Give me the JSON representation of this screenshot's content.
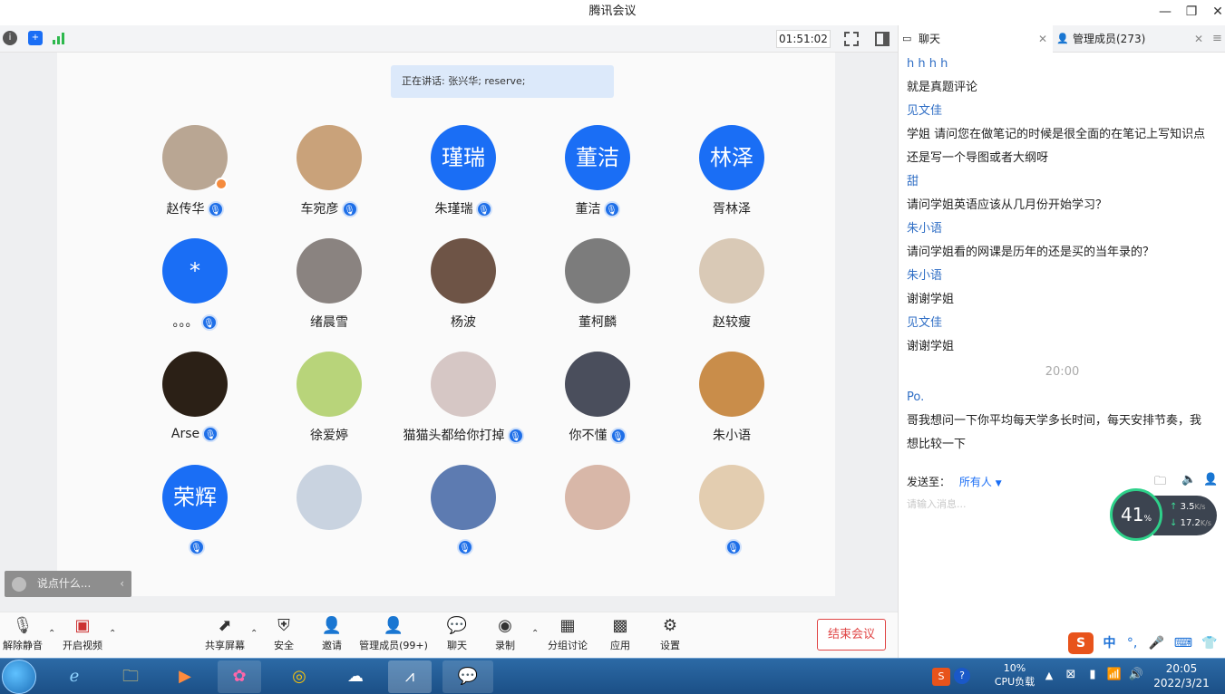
{
  "window": {
    "title": "腾讯会议",
    "controls": [
      "—",
      "❐",
      "✕"
    ]
  },
  "topbar": {
    "timer": "01:51:02"
  },
  "stage": {
    "speaking": "正在讲话: 张兴华; reserve;",
    "participants": [
      {
        "name": "赵传华",
        "avatar_text": "",
        "avatar_color": "#b9a693",
        "mic": true,
        "host": true
      },
      {
        "name": "车宛彦",
        "avatar_text": "",
        "avatar_color": "#c9a27a",
        "mic": true,
        "host": false
      },
      {
        "name": "朱瑾瑞",
        "avatar_text": "瑾瑞",
        "avatar_color": "#1a6ef5",
        "mic": true,
        "host": false
      },
      {
        "name": "董洁",
        "avatar_text": "董洁",
        "avatar_color": "#1a6ef5",
        "mic": true,
        "host": false
      },
      {
        "name": "胥林泽",
        "avatar_text": "林泽",
        "avatar_color": "#1a6ef5",
        "mic": false,
        "host": false
      },
      {
        "name": "。。。",
        "avatar_text": "*",
        "avatar_color": "#1a6ef5",
        "mic": true,
        "host": false
      },
      {
        "name": "绪晨雪",
        "avatar_text": "",
        "avatar_color": "#8a8380",
        "mic": false,
        "host": false
      },
      {
        "name": "杨波",
        "avatar_text": "",
        "avatar_color": "#6e5446",
        "mic": false,
        "host": false
      },
      {
        "name": "董柯麟",
        "avatar_text": "",
        "avatar_color": "#7c7c7c",
        "mic": false,
        "host": false
      },
      {
        "name": "赵较瘦",
        "avatar_text": "",
        "avatar_color": "#d9c9b6",
        "mic": false,
        "host": false
      },
      {
        "name": "Arse",
        "avatar_text": "",
        "avatar_color": "#2b2016",
        "mic": true,
        "host": false
      },
      {
        "name": "徐爱婷",
        "avatar_text": "",
        "avatar_color": "#b8d47a",
        "mic": false,
        "host": false
      },
      {
        "name": "猫猫头都给你打掉",
        "avatar_text": "",
        "avatar_color": "#d6c7c5",
        "mic": true,
        "host": false
      },
      {
        "name": "你不懂",
        "avatar_text": "",
        "avatar_color": "#4a4e5c",
        "mic": true,
        "host": false
      },
      {
        "name": "朱小语",
        "avatar_text": "",
        "avatar_color": "#c98d4a",
        "mic": false,
        "host": false
      },
      {
        "name": "",
        "avatar_text": "荣辉",
        "avatar_color": "#1a6ef5",
        "mic": true,
        "host": false
      },
      {
        "name": "",
        "avatar_text": "",
        "avatar_color": "#c9d3e0",
        "mic": false,
        "host": false
      },
      {
        "name": "",
        "avatar_text": "",
        "avatar_color": "#5d7bb1",
        "mic": true,
        "host": false
      },
      {
        "name": "",
        "avatar_text": "",
        "avatar_color": "#d8b7a8",
        "mic": false,
        "host": false
      },
      {
        "name": "",
        "avatar_text": "",
        "avatar_color": "#e3cdb0",
        "mic": true,
        "host": false
      }
    ],
    "chat_mini_placeholder": "说点什么..."
  },
  "toolbar": {
    "unmute": "解除静音",
    "video": "开启视频",
    "share": "共享屏幕",
    "security": "安全",
    "invite": "邀请",
    "members": "管理成员(99+)",
    "chat": "聊天",
    "record": "录制",
    "breakout": "分组讨论",
    "apps": "应用",
    "settings": "设置",
    "end": "结束会议"
  },
  "panel": {
    "tab_chat": "聊天",
    "tab_members": "管理成员(273)",
    "messages": [
      {
        "type": "sender",
        "text": "h h h h"
      },
      {
        "type": "text",
        "text": "就是真题评论"
      },
      {
        "type": "sender",
        "text": "见文佳"
      },
      {
        "type": "text",
        "text": "学姐 请问您在做笔记的时候是很全面的在笔记上写知识点"
      },
      {
        "type": "text",
        "text": "还是写一个导图或者大纲呀"
      },
      {
        "type": "sender",
        "text": "甜"
      },
      {
        "type": "text",
        "text": "请问学姐英语应该从几月份开始学习？"
      },
      {
        "type": "sender",
        "text": "朱小语"
      },
      {
        "type": "text",
        "text": "请问学姐看的网课是历年的还是买的当年录的？"
      },
      {
        "type": "sender",
        "text": "朱小语"
      },
      {
        "type": "text",
        "text": "谢谢学姐"
      },
      {
        "type": "sender",
        "text": "见文佳"
      },
      {
        "type": "text",
        "text": "谢谢学姐"
      },
      {
        "type": "time",
        "text": "20:00"
      },
      {
        "type": "sender",
        "text": "Po."
      },
      {
        "type": "text",
        "text": "哥我想问一下你平均每天学多长时间，每天安排节奏，我"
      },
      {
        "type": "text",
        "text": "想比较一下"
      }
    ],
    "send_to_label": "发送至：",
    "send_to_value": "所有人",
    "input_placeholder": "请输入消息...",
    "net": {
      "percent": "41",
      "unit": "%",
      "up": "3.5",
      "down": "17.2",
      "speed_unit": "K/s"
    }
  },
  "ime": {
    "label": "中"
  },
  "taskbar": {
    "cpu_percent": "10%",
    "cpu_label": "CPU负载",
    "time": "20:05",
    "date": "2022/3/21"
  },
  "colors": {
    "accent": "#1a6ef5",
    "danger": "#e04646",
    "link": "#2f6ec5"
  }
}
